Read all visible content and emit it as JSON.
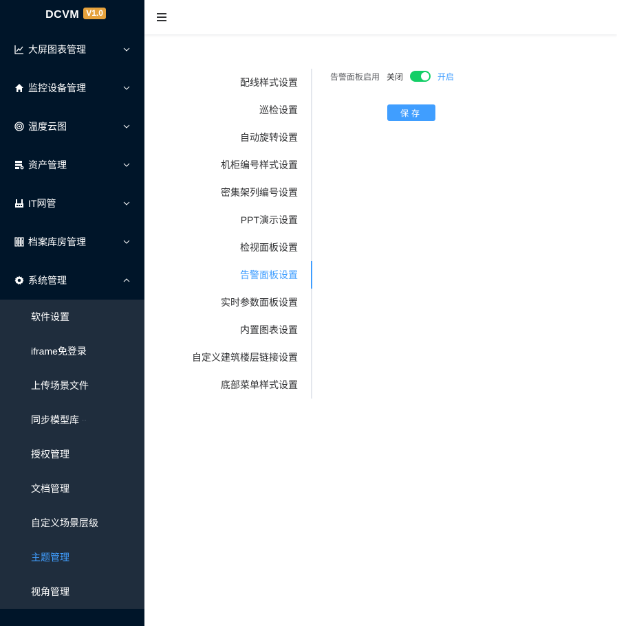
{
  "brand": {
    "name": "DCVM",
    "version": "V1.0"
  },
  "sidebar": {
    "menus": [
      {
        "label": "大屏图表管理",
        "icon": "line-chart-icon"
      },
      {
        "label": "监控设备管理",
        "icon": "home-icon"
      },
      {
        "label": "温度云图",
        "icon": "target-icon"
      },
      {
        "label": "资产管理",
        "icon": "server-gear-icon"
      },
      {
        "label": "IT网管",
        "icon": "network-switch-icon"
      },
      {
        "label": "档案库房管理",
        "icon": "archive-shelf-icon"
      },
      {
        "label": "系统管理",
        "icon": "gear-icon"
      }
    ],
    "system_submenu": [
      {
        "label": "软件设置"
      },
      {
        "label": "iframe免登录"
      },
      {
        "label": "上传场景文件"
      },
      {
        "label": "同步模型库",
        "extra": "··"
      },
      {
        "label": "授权管理"
      },
      {
        "label": "文档管理"
      },
      {
        "label": "自定义场景层级"
      },
      {
        "label": "主题管理",
        "active": true
      },
      {
        "label": "视角管理"
      }
    ]
  },
  "header": {
    "menu_toggle": "hamburger-icon"
  },
  "settings_tabs": [
    "配线样式设置",
    "巡检设置",
    "自动旋转设置",
    "机柜编号样式设置",
    "密集架列编号设置",
    "PPT演示设置",
    "检视面板设置",
    "告警面板设置",
    "实时参数面板设置",
    "内置图表设置",
    "自定义建筑楼层链接设置",
    "底部菜单样式设置"
  ],
  "active_tab": "告警面板设置",
  "panel": {
    "field_label": "告警面板启用",
    "switch_off_text": "关闭",
    "switch_on_text": "开启",
    "switch_value": true,
    "save_label": "保存"
  },
  "colors": {
    "sidebar_bg": "#001529",
    "submenu_bg": "#1f2d3d",
    "accent": "#409eff",
    "switch_on": "#13ce66",
    "version_badge": "#e6a23c"
  }
}
